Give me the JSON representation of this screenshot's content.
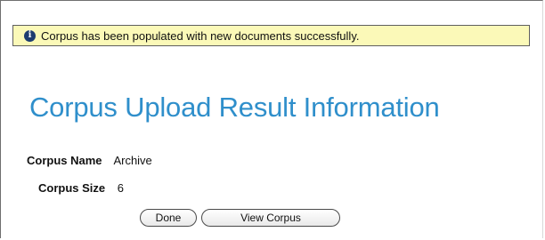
{
  "notice": {
    "icon": "info-icon",
    "icon_glyph": "i",
    "message": "Corpus has been populated with new documents successfully."
  },
  "page": {
    "title": "Corpus Upload Result Information"
  },
  "details": {
    "corpus_name": {
      "label": "Corpus Name",
      "value": "Archive"
    },
    "corpus_size": {
      "label": "Corpus Size",
      "value": "6"
    }
  },
  "actions": {
    "done_label": "Done",
    "view_corpus_label": "View Corpus"
  },
  "colors": {
    "notice_background": "#fbf9b8",
    "title": "#2f8fcb",
    "info_icon": "#1d3c6f"
  }
}
